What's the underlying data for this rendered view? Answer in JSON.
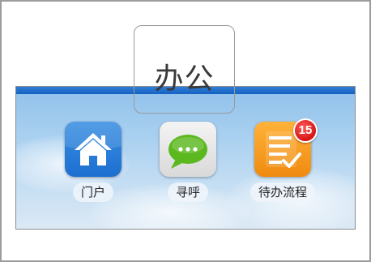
{
  "section": {
    "title": "办公"
  },
  "apps": [
    {
      "label": "门户",
      "icon": "home-icon"
    },
    {
      "label": "寻呼",
      "icon": "chat-bubble-icon"
    },
    {
      "label": "待办流程",
      "icon": "task-list-icon",
      "badge": "15"
    }
  ],
  "colors": {
    "top_bar": "#1560c2",
    "portal_icon_bg": "#1d6fd0",
    "page_icon_bubble": "#5bb81f",
    "todo_icon_bg": "#f08a10",
    "badge": "#d61414"
  }
}
